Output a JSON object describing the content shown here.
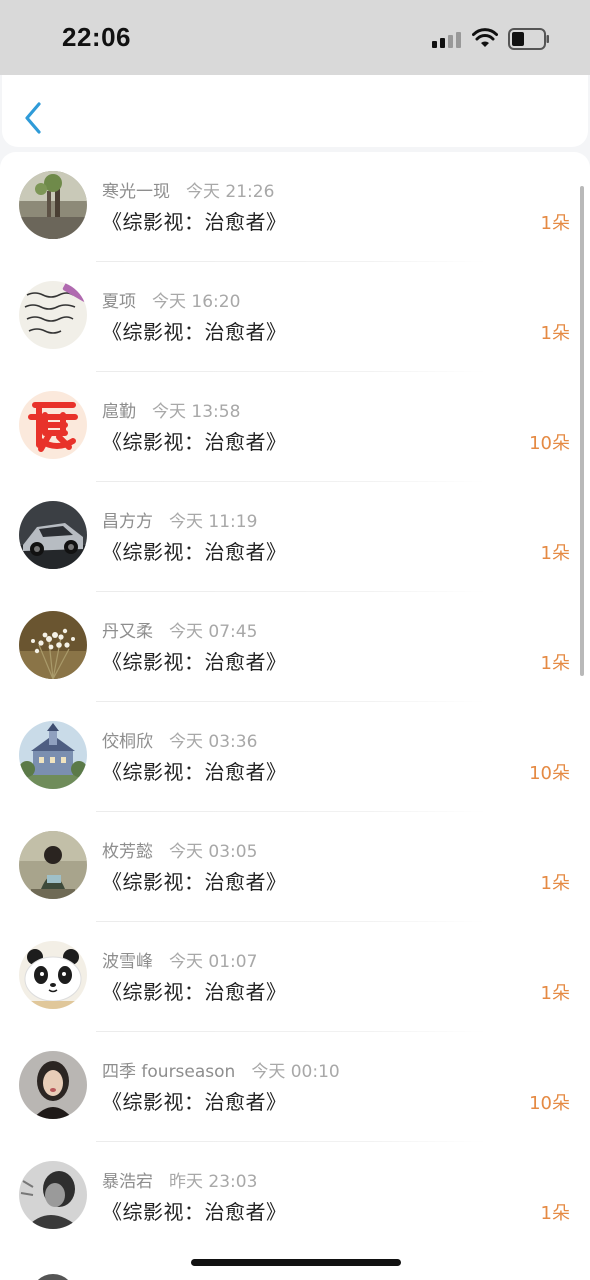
{
  "status_bar": {
    "time": "22:06"
  },
  "messages": [
    {
      "user": "寒光一现",
      "time": "今天 21:26",
      "book": "《综影视：治愈者》",
      "count": "1朵",
      "avatar": "tree-photo"
    },
    {
      "user": "夏项",
      "time": "今天 16:20",
      "book": "《综影视：治愈者》",
      "count": "1朵",
      "avatar": "handwriting-note"
    },
    {
      "user": "扈勤",
      "time": "今天 13:58",
      "book": "《综影视：治愈者》",
      "count": "10朵",
      "avatar": "red-character"
    },
    {
      "user": "昌方方",
      "time": "今天 11:19",
      "book": "《综影视：治愈者》",
      "count": "1朵",
      "avatar": "sports-car"
    },
    {
      "user": "丹又柔",
      "time": "今天 07:45",
      "book": "《综影视：治愈者》",
      "count": "1朵",
      "avatar": "white-flowers"
    },
    {
      "user": "佼桐欣",
      "time": "今天 03:36",
      "book": "《综影视：治愈者》",
      "count": "10朵",
      "avatar": "castle"
    },
    {
      "user": "枚芳懿",
      "time": "今天 03:05",
      "book": "《综影视：治愈者》",
      "count": "1朵",
      "avatar": "girl-reading"
    },
    {
      "user": "波雪峰",
      "time": "今天 01:07",
      "book": "《综影视：治愈者》",
      "count": "1朵",
      "avatar": "panda-plush"
    },
    {
      "user": "四季 fourseason",
      "time": "今天 00:10",
      "book": "《综影视：治愈者》",
      "count": "10朵",
      "avatar": "woman-portrait"
    },
    {
      "user": "暴浩宕",
      "time": "昨天 23:03",
      "book": "《综影视：治愈者》",
      "count": "1朵",
      "avatar": "bw-portrait"
    }
  ],
  "colors": {
    "accent": "#e58a43",
    "back": "#2f9bd8"
  }
}
